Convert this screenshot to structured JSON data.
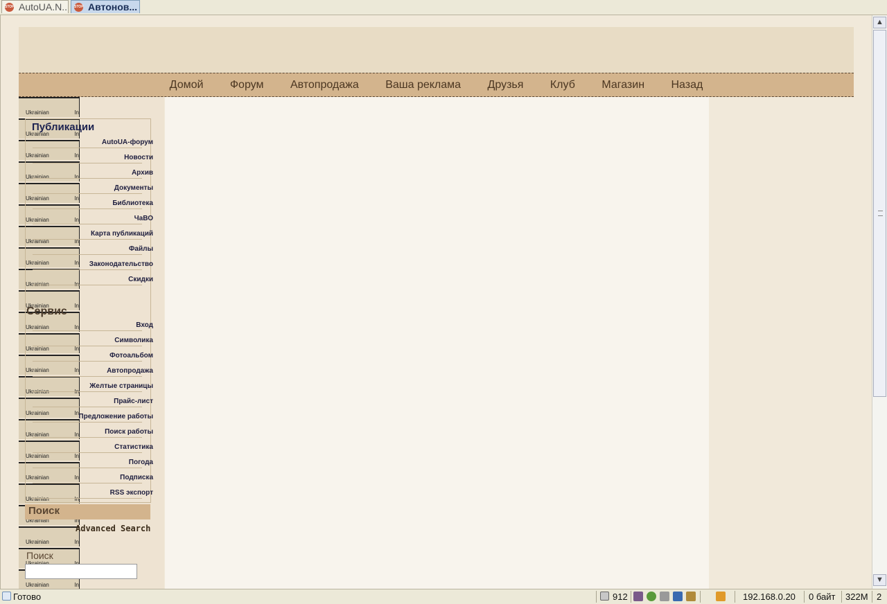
{
  "browser": {
    "tabs": [
      {
        "label": "AutoUA.N..."
      },
      {
        "label": "Автонов..."
      }
    ]
  },
  "topnav": {
    "items": [
      "Домой",
      "Форум",
      "Автопродажа",
      "Ваша реклама",
      "Друзья",
      "Клуб",
      "Магазин",
      "Назад"
    ]
  },
  "ukr_strip": {
    "left_text": "Ukrainian",
    "right_text": "In"
  },
  "sidebar": {
    "publications_title": "Публикации",
    "publications": [
      "AutoUA-форум",
      "Новости",
      "Архив",
      "Документы",
      "Библиотека",
      "ЧаВО",
      "Карта публикаций",
      "Файлы",
      "Законодательство",
      "Скидки"
    ],
    "service_title": "Сервис",
    "service": [
      "Вход",
      "Символика",
      "Фотоальбом",
      "Автопродажа",
      "Желтые страницы",
      "Прайс-лист",
      "Предложение работы",
      "Поиск работы",
      "Статистика",
      "Погода",
      "Подписка",
      "RSS экспорт"
    ],
    "search_title": "Поиск",
    "advanced_search": "Advanced Search",
    "search_label": "Поиск",
    "search_value": ""
  },
  "status": {
    "text": "Готово",
    "count": "912",
    "ip": "192.168.0.20",
    "bytes": "0 байт",
    "memory": "322M",
    "extra": "2"
  },
  "colors": {
    "nav_bg": "#d3b48d",
    "banner_bg": "#e8dcc5",
    "page_bg": "#f1e9da",
    "section_title": "#1d2350"
  }
}
